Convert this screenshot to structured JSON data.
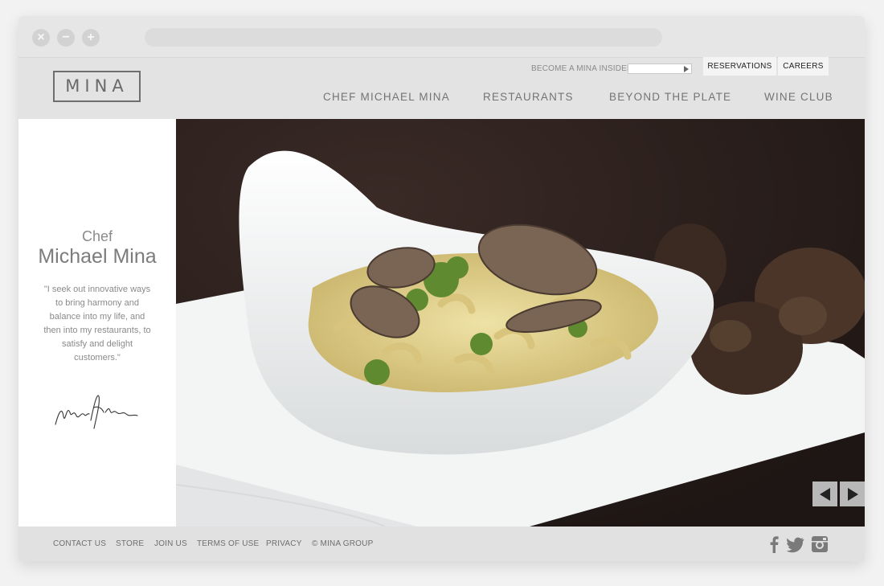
{
  "browser": {
    "controls": [
      "×",
      "−",
      "+"
    ]
  },
  "brand": {
    "logo_text": "MINA"
  },
  "topbar": {
    "insider_label": "BECOME A MINA INSIDER",
    "insider_input_value": "",
    "reservations_label": "RESERVATIONS",
    "careers_label": "CAREERS"
  },
  "nav": {
    "items": [
      {
        "label": "CHEF MICHAEL MINA"
      },
      {
        "label": "RESTAURANTS"
      },
      {
        "label": "BEYOND THE PLATE"
      },
      {
        "label": "WINE CLUB"
      }
    ]
  },
  "sidebar": {
    "title_small": "Chef",
    "title_big": "Michael Mina",
    "quote": "\"I seek out innovative ways to bring harmony and balance into my life, and then into my restaurants, to satisfy and delight customers.\"",
    "signature_icon": "signature"
  },
  "hero": {
    "image_subject": "truffle-pasta-bowl",
    "prev_icon": "arrow-left-icon",
    "next_icon": "arrow-right-icon"
  },
  "footer": {
    "links": [
      {
        "label": "CONTACT US"
      },
      {
        "label": "STORE"
      },
      {
        "label": "JOIN US"
      },
      {
        "label": "TERMS OF USE"
      },
      {
        "label": "PRIVACY"
      },
      {
        "label": "© MINA GROUP"
      }
    ],
    "social": [
      "facebook-icon",
      "twitter-icon",
      "instagram-icon"
    ]
  },
  "colors": {
    "header_bg": "#e3e3e3",
    "sidebar_bg": "#ffffff",
    "text_gray": "#747474",
    "footer_bg": "#e1e1e1"
  }
}
